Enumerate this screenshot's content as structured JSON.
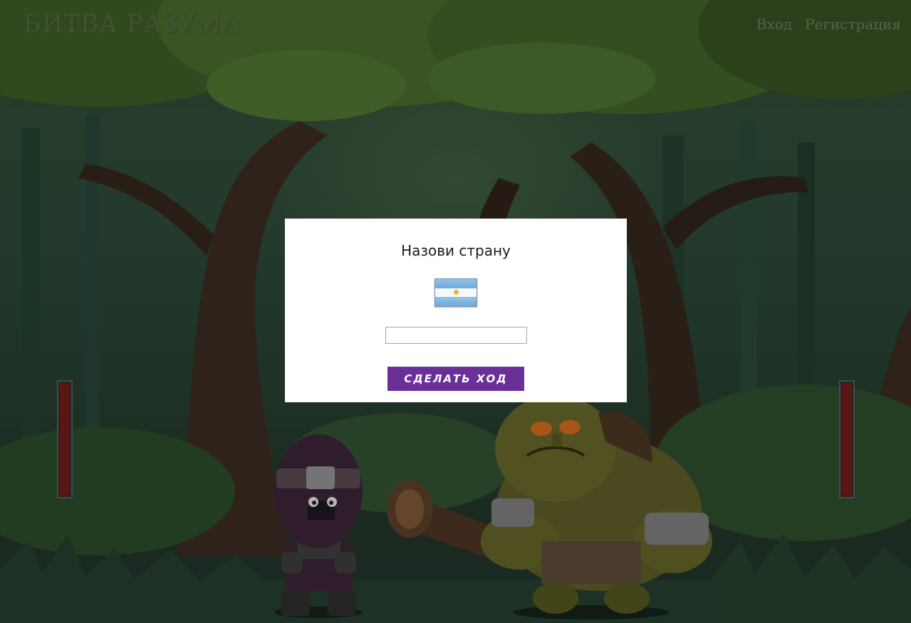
{
  "header": {
    "logo": "БИТВА РАЗУМА",
    "login": "Вход",
    "register": "Регистрация"
  },
  "game": {
    "player_hp": 1.0,
    "enemy_hp": 1.0,
    "player_character": "ninja",
    "enemy_character": "troll"
  },
  "dialog": {
    "title": "Назови страну",
    "flag": "argentina-flag",
    "answer_value": "",
    "submit_label": "СДЕЛАТЬ ХОД"
  },
  "colors": {
    "button": "#6a2f98",
    "hp_fill": "#6e1a1a"
  }
}
